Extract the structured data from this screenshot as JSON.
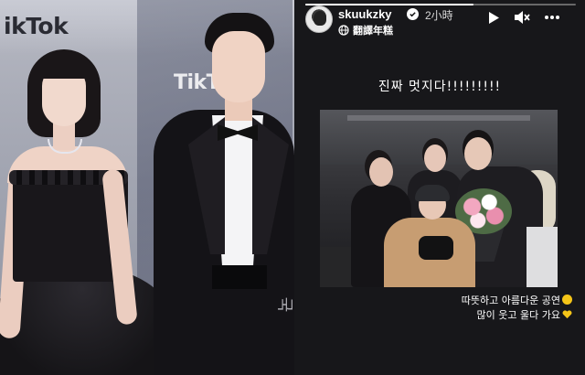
{
  "left_photo": {
    "backdrop_text_a": "ikTok",
    "backdrop_text_b": "TikT",
    "side_text": "국"
  },
  "story": {
    "progress": 0.62,
    "username": "skuukzky",
    "time": "2小時",
    "translate_label": "翻譯年糕",
    "caption": "진짜 멋지다!!!!!!!!!",
    "sticker_line1": "따뜻하고 아름다운 공연",
    "sticker_line2": "많이 웃고 울다 가요",
    "icons": {
      "verified": "verified-badge-icon",
      "translate": "globe-icon",
      "play": "play-icon",
      "mute": "mute-icon",
      "more": "more-icon"
    },
    "colors": {
      "background": "#17171a",
      "emoji_yellow": "#f5c518",
      "heart": "#f5c518"
    }
  }
}
